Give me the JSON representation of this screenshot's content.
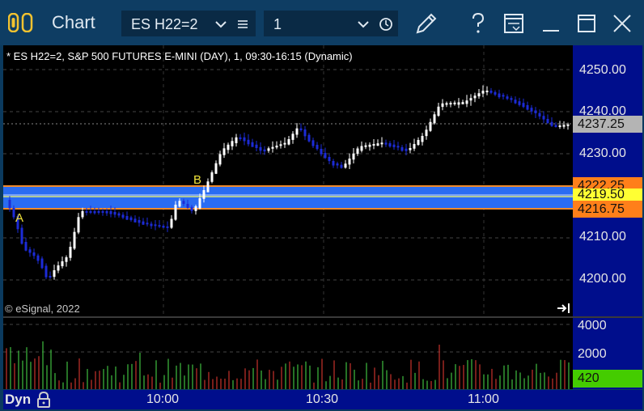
{
  "window": {
    "title": "Chart",
    "symbol": "ES H22=2",
    "interval": "1"
  },
  "chart": {
    "header": "* ES H22=2, S&P 500 FUTURES E-MINI (DAY), 1, 09:30-16:15 (Dynamic)",
    "copyright": "© eSignal, 2022",
    "marker_a": "A",
    "marker_b": "B",
    "price_labels": [
      "4250.00",
      "4240.00",
      "4230.00",
      "4210.00",
      "4200.00"
    ],
    "price_tags": {
      "last": "4237.25",
      "upper": "4222.25",
      "mid": "4219.50",
      "lower": "4216.75"
    },
    "volume_labels": [
      "4000",
      "2000"
    ],
    "volume_tag": "420",
    "time_labels": [
      "10:00",
      "10:30",
      "11:00"
    ],
    "dyn": "Dyn"
  },
  "colors": {
    "up_candle": "#ffffff",
    "down_candle": "#1c2bd6",
    "band": "#2a6cf2",
    "band_border": "#f08a2a",
    "axis_bg": "#000e8c",
    "last_tag": "#b4b4b4",
    "upper_tag": "#ff7f1a",
    "mid_tag": "#ffff33",
    "vol_up": "#3fbf3f",
    "vol_down": "#c8322c",
    "vol_tag": "#44cc00"
  }
}
